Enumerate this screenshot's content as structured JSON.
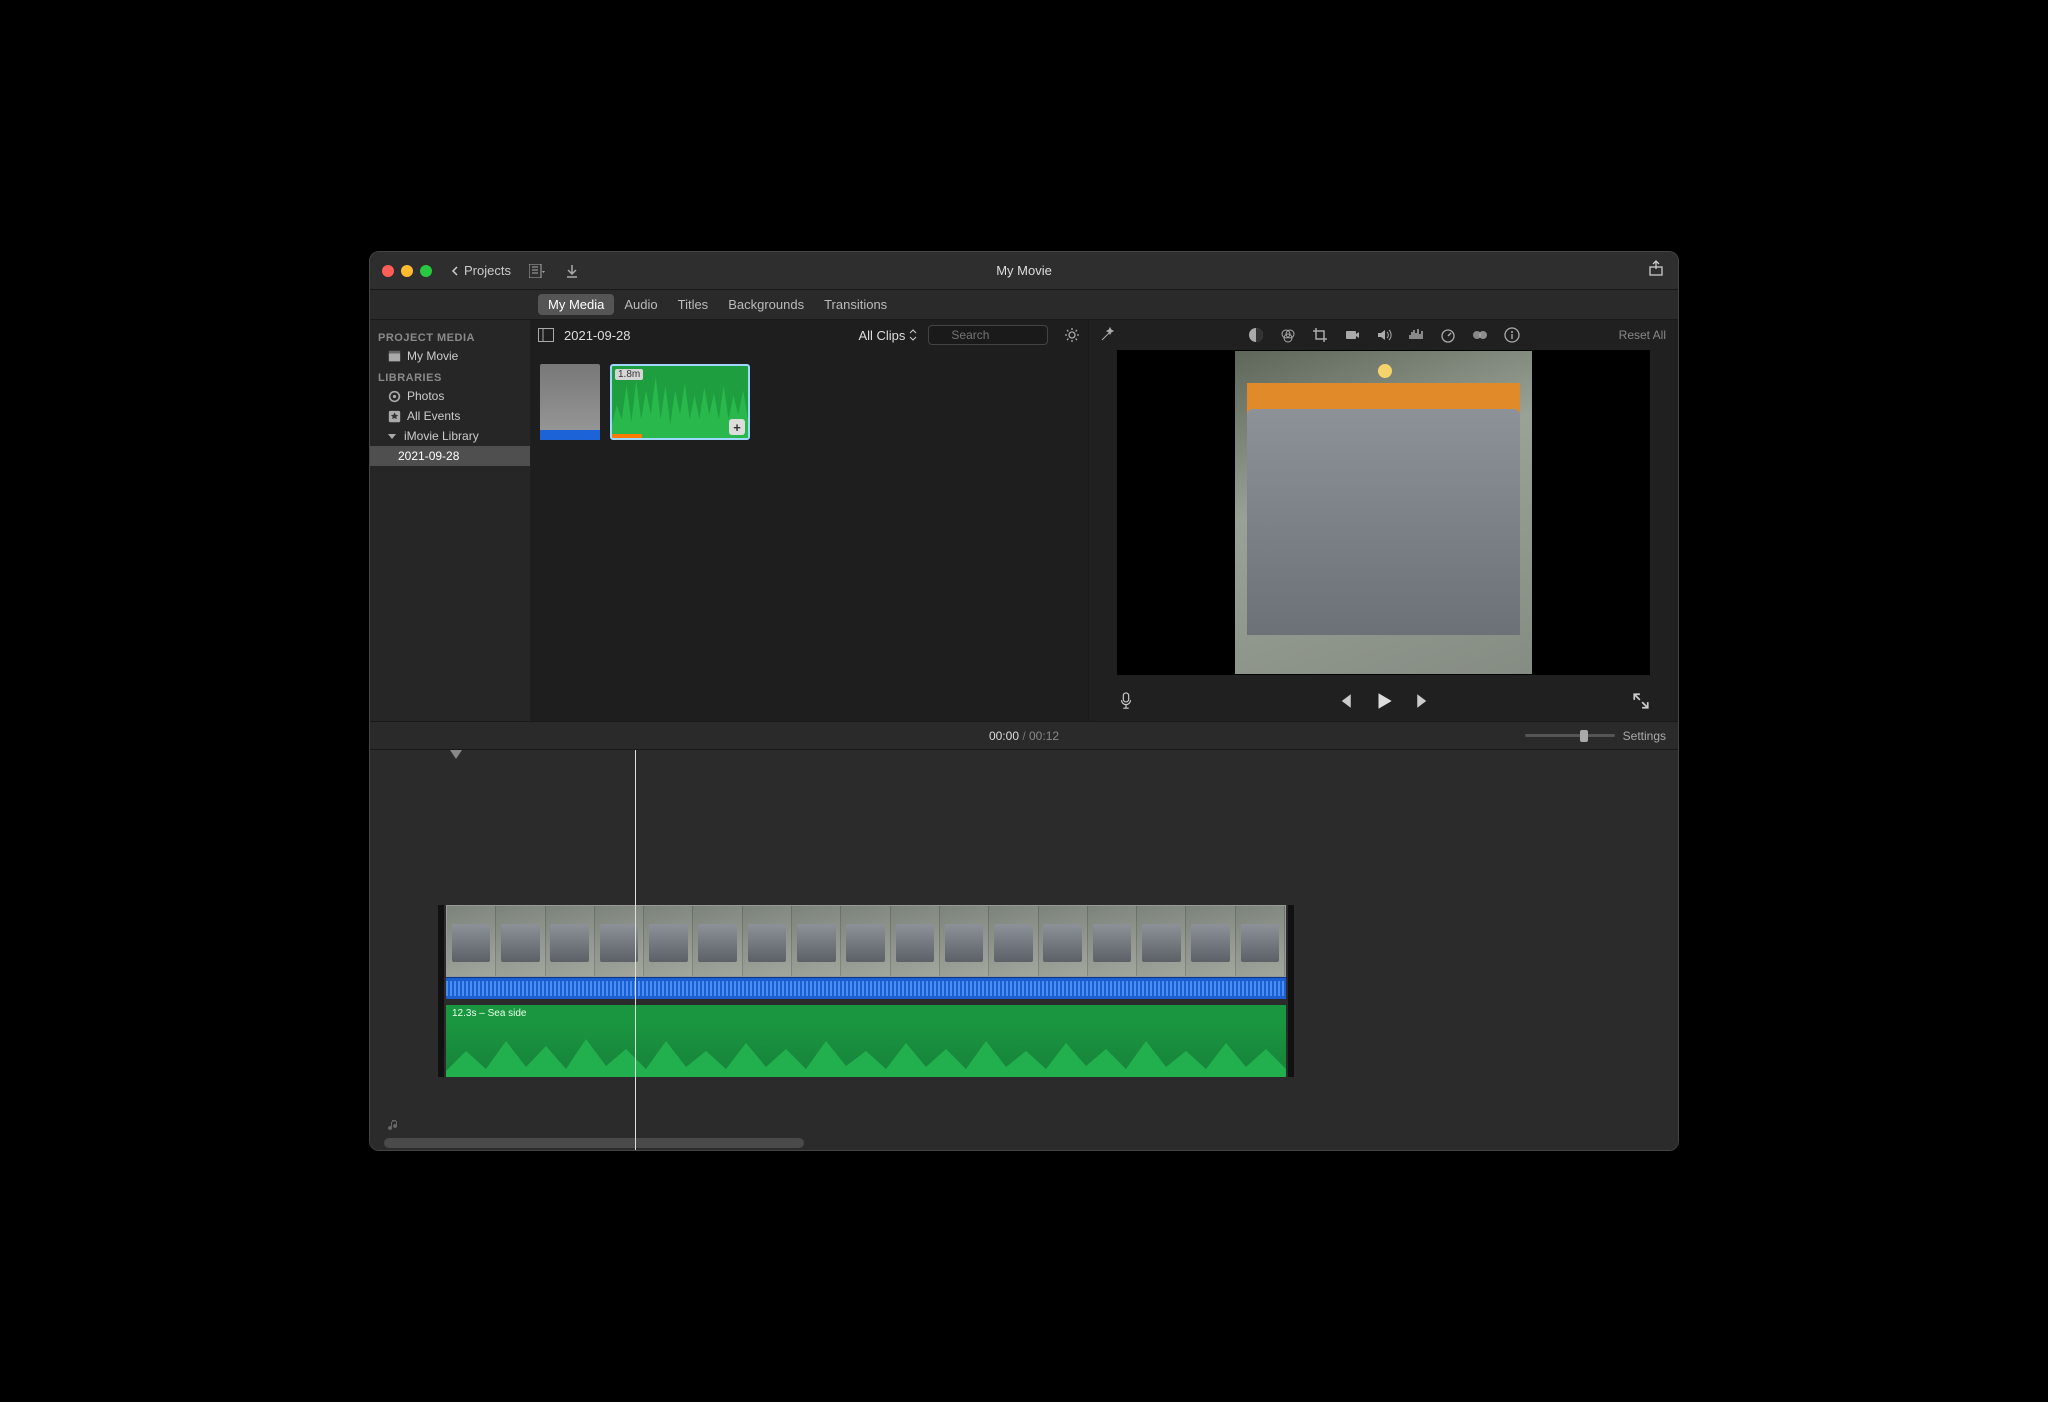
{
  "window": {
    "title": "My Movie"
  },
  "toolbar": {
    "back_label": "Projects",
    "reset_label": "Reset All",
    "settings_label": "Settings"
  },
  "tabs": {
    "my_media": "My Media",
    "audio": "Audio",
    "titles": "Titles",
    "backgrounds": "Backgrounds",
    "transitions": "Transitions"
  },
  "sidebar": {
    "project_media_hdr": "PROJECT MEDIA",
    "movie_item": "My Movie",
    "libraries_hdr": "LIBRARIES",
    "photos_item": "Photos",
    "all_events_item": "All Events",
    "imovie_library_item": "iMovie Library",
    "event_item": "2021-09-28"
  },
  "browser": {
    "event_title": "2021-09-28",
    "filter_label": "All Clips",
    "search_placeholder": "Search",
    "audio_clip_duration": "1.8m"
  },
  "timeline": {
    "current_time": "00:00",
    "total_time": "00:12",
    "music_label": "12.3s – Sea side"
  }
}
